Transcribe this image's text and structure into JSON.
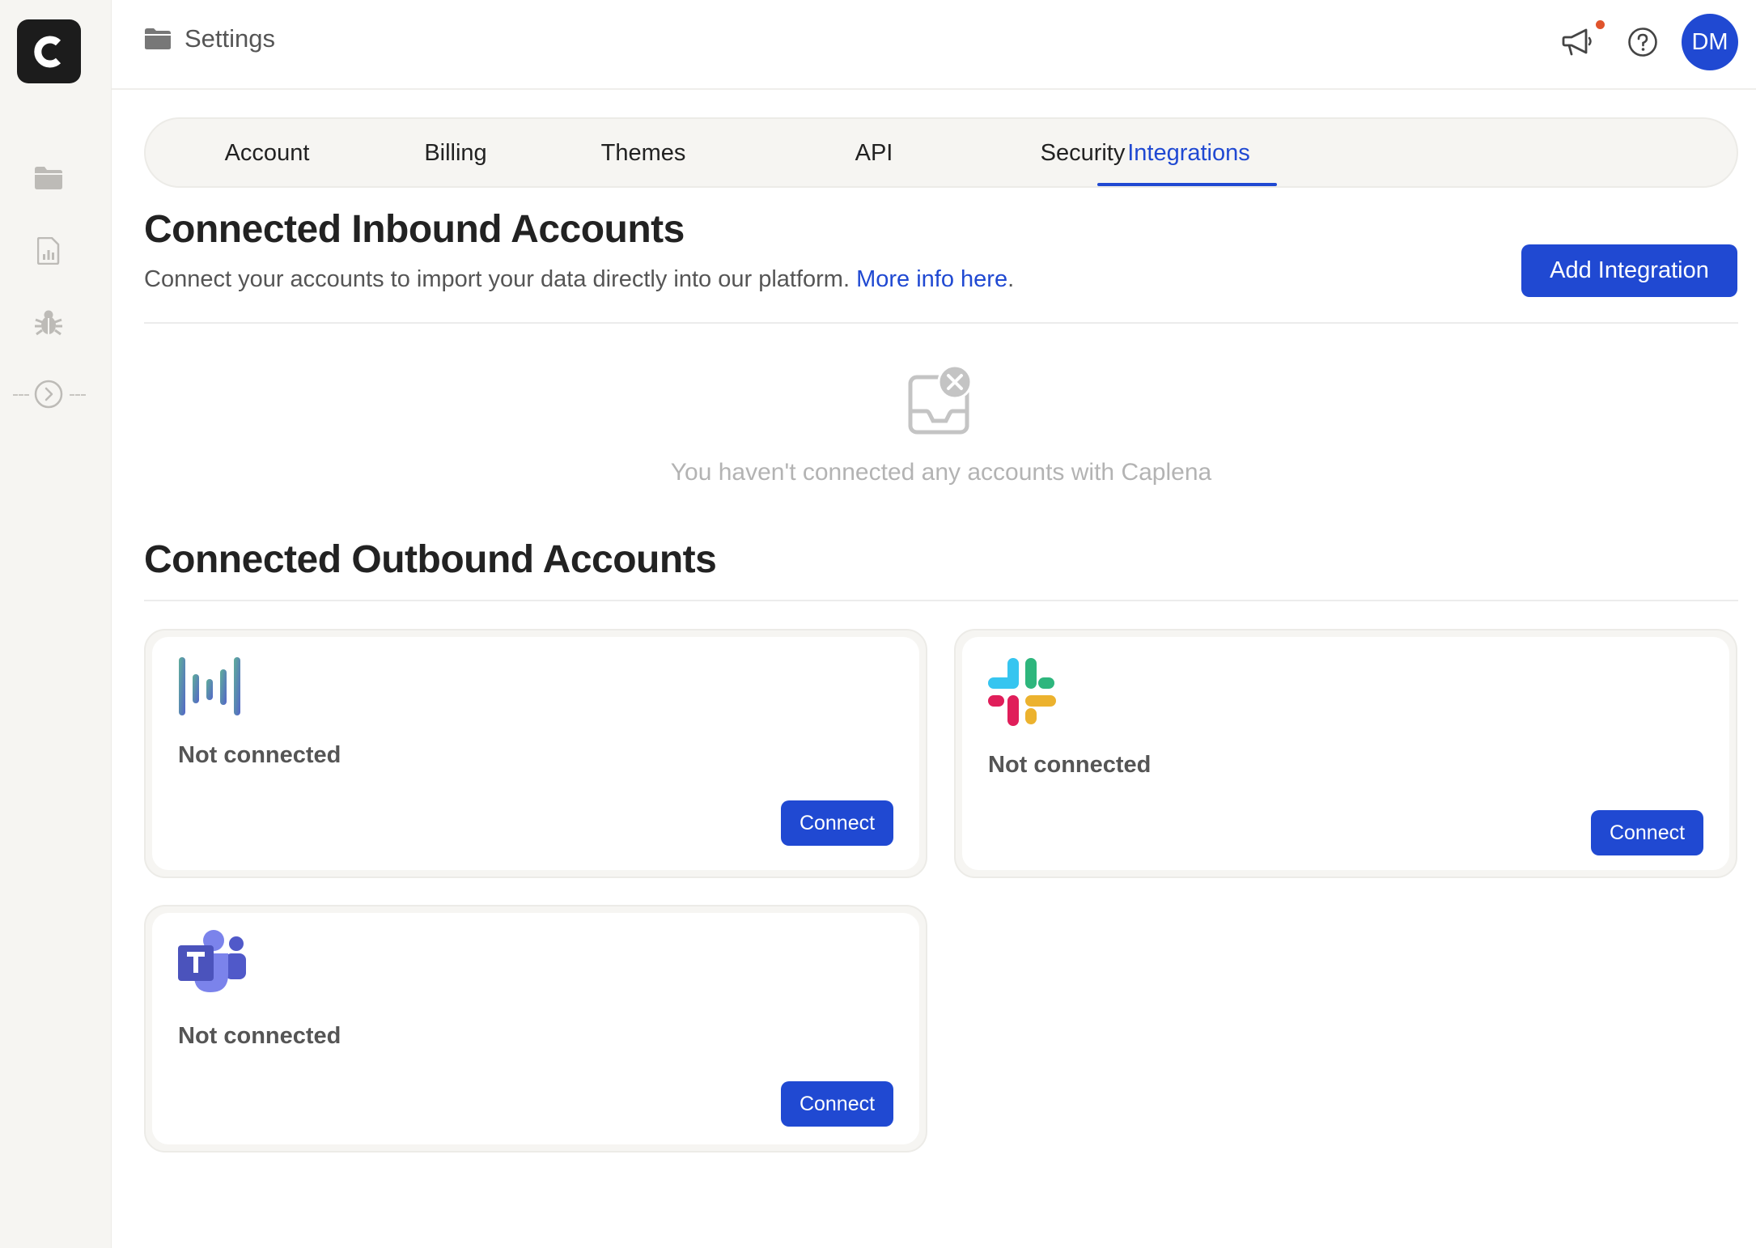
{
  "app": {
    "logo_letter": "C"
  },
  "sidebar": {
    "items": [
      {
        "icon": "folder-icon"
      },
      {
        "icon": "report-icon"
      },
      {
        "icon": "bug-icon"
      },
      {
        "icon": "expand-icon"
      }
    ]
  },
  "header": {
    "breadcrumb": "Settings",
    "avatar_initials": "DM"
  },
  "tabs": [
    {
      "label": "Account"
    },
    {
      "label": "Billing"
    },
    {
      "label": "Themes"
    },
    {
      "label": "API"
    },
    {
      "label": "Security"
    },
    {
      "label": "Integrations",
      "active": true
    }
  ],
  "inbound": {
    "title": "Connected Inbound Accounts",
    "description": "Connect your accounts to import your data directly into our platform.",
    "link_text": "More info here",
    "link_suffix": ".",
    "add_button": "Add Integration",
    "empty_text": "You haven't connected any accounts with Caplena"
  },
  "outbound": {
    "title": "Connected Outbound Accounts",
    "cards": [
      {
        "service_icon": "intercom-icon",
        "status": "Not connected",
        "button": "Connect"
      },
      {
        "service_icon": "slack-icon",
        "status": "Not connected",
        "button": "Connect"
      },
      {
        "service_icon": "teams-icon",
        "status": "Not connected",
        "button": "Connect"
      }
    ]
  },
  "colors": {
    "primary": "#2049d2",
    "sidebar_bg": "#f6f5f2",
    "notification": "#e0542c"
  }
}
